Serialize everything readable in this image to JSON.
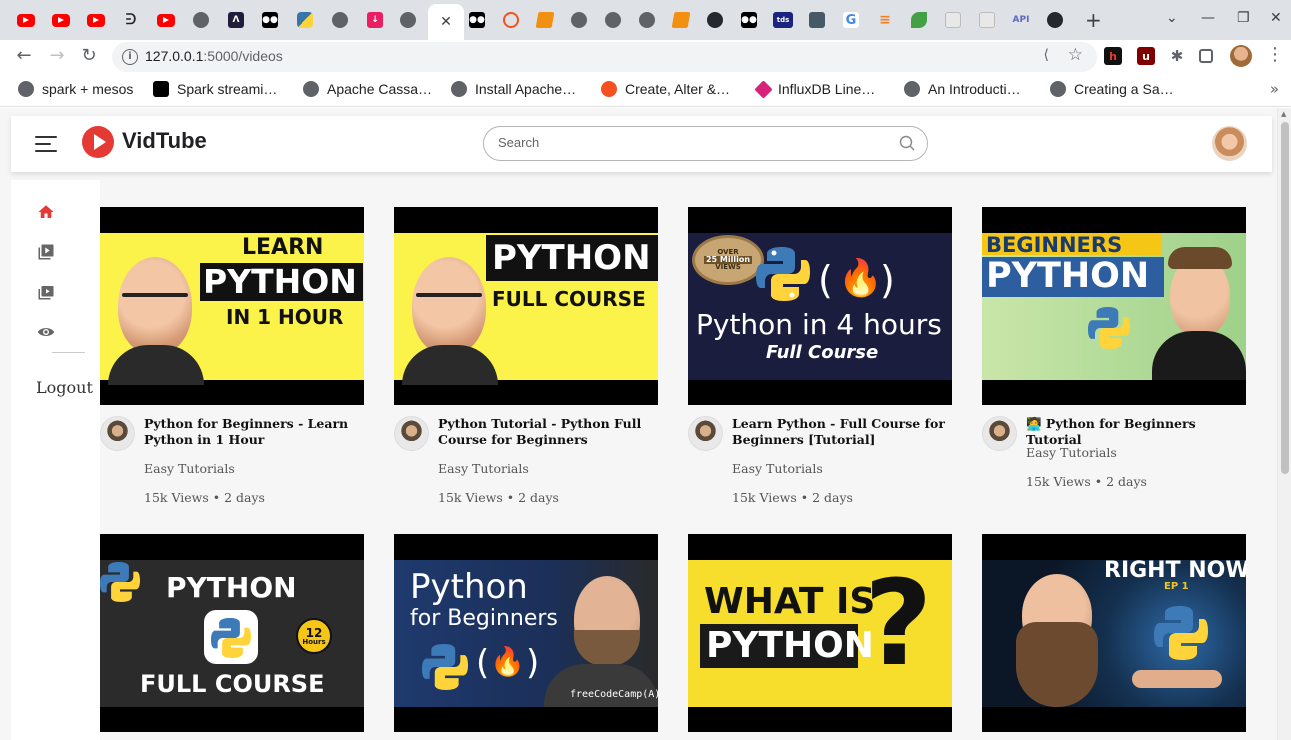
{
  "browser": {
    "active_tab_close": "✕",
    "new_tab": "+",
    "url_host": "127.0.0.1",
    "url_path": ":5000/videos",
    "tab_icons": [
      "youtube-icon",
      "youtube-icon",
      "youtube-icon",
      "curl-icon",
      "youtube-icon",
      "globe-icon",
      "dark-icon",
      "medium-icon",
      "python-icon",
      "globe-icon",
      "download-icon",
      "globe-icon",
      "close-icon",
      "medium-icon",
      "ring-icon",
      "orange-icon",
      "globe-icon",
      "globe-icon",
      "globe-icon",
      "orange-icon",
      "github-icon",
      "medium-icon",
      "tds-icon",
      "hex-icon",
      "google-icon",
      "stackoverflow-icon",
      "leaf-icon",
      "grey-icon",
      "grey-icon",
      "api-icon",
      "github-icon"
    ],
    "tds_label": "tds",
    "api_label": "API",
    "google_label": "G"
  },
  "bookmarks": [
    {
      "label": "spark + mesos",
      "icon": "globe-icon"
    },
    {
      "label": "Spark streami…",
      "icon": "medium-icon"
    },
    {
      "label": "Apache Cassa…",
      "icon": "globe-icon"
    },
    {
      "label": "Install Apache…",
      "icon": "globe-icon"
    },
    {
      "label": "Create, Alter &…",
      "icon": "ring-icon"
    },
    {
      "label": "InfluxDB Line…",
      "icon": "influx-icon"
    },
    {
      "label": "An Introducti…",
      "icon": "globe-icon"
    },
    {
      "label": "Creating a Sa…",
      "icon": "globe-icon"
    }
  ],
  "bookmarks_more": "»",
  "app": {
    "name": "VidTube",
    "search_placeholder": "Search",
    "logout_label": "Logout"
  },
  "thumb_text": {
    "v1": {
      "l1": "LEARN",
      "l2": "PYTHON",
      "l3": "IN 1 HOUR"
    },
    "v2": {
      "l1": "PYTHON",
      "l2": "FULL COURSE"
    },
    "v3": {
      "badge1": "OVER",
      "badge2": "25 Million",
      "badge3": "VIEWS",
      "l1": "Python in 4 hours",
      "l2": "Full Course"
    },
    "v4": {
      "l1": "BEGINNERS",
      "l2": "PYTHON"
    },
    "v5": {
      "l1": "PYTHON",
      "l2": "FULL COURSE",
      "badge1": "12",
      "badge2": "Hours"
    },
    "v6": {
      "l1": "Python",
      "l2": "for Beginners",
      "l3": "freeCodeCamp(A)"
    },
    "v7": {
      "l1": "WHAT IS",
      "l2": "PYTHON",
      "l3": "?"
    },
    "v8": {
      "l1": "RIGHT NOW!!",
      "l2": "EP 1"
    }
  },
  "videos": [
    {
      "title": "Python for Beginners - Learn Python in 1 Hour",
      "channel": "Easy Tutorials",
      "views": "15k Views • 2 days"
    },
    {
      "title": "Python Tutorial - Python Full Course for Beginners",
      "channel": "Easy Tutorials",
      "views": "15k Views • 2 days"
    },
    {
      "title": "Learn Python - Full Course for Beginners [Tutorial]",
      "channel": "Easy Tutorials",
      "views": "15k Views • 2 days"
    },
    {
      "title": "🧑‍💻 Python for Beginners Tutorial",
      "channel": "Easy Tutorials",
      "views": "15k Views • 2 days"
    }
  ]
}
